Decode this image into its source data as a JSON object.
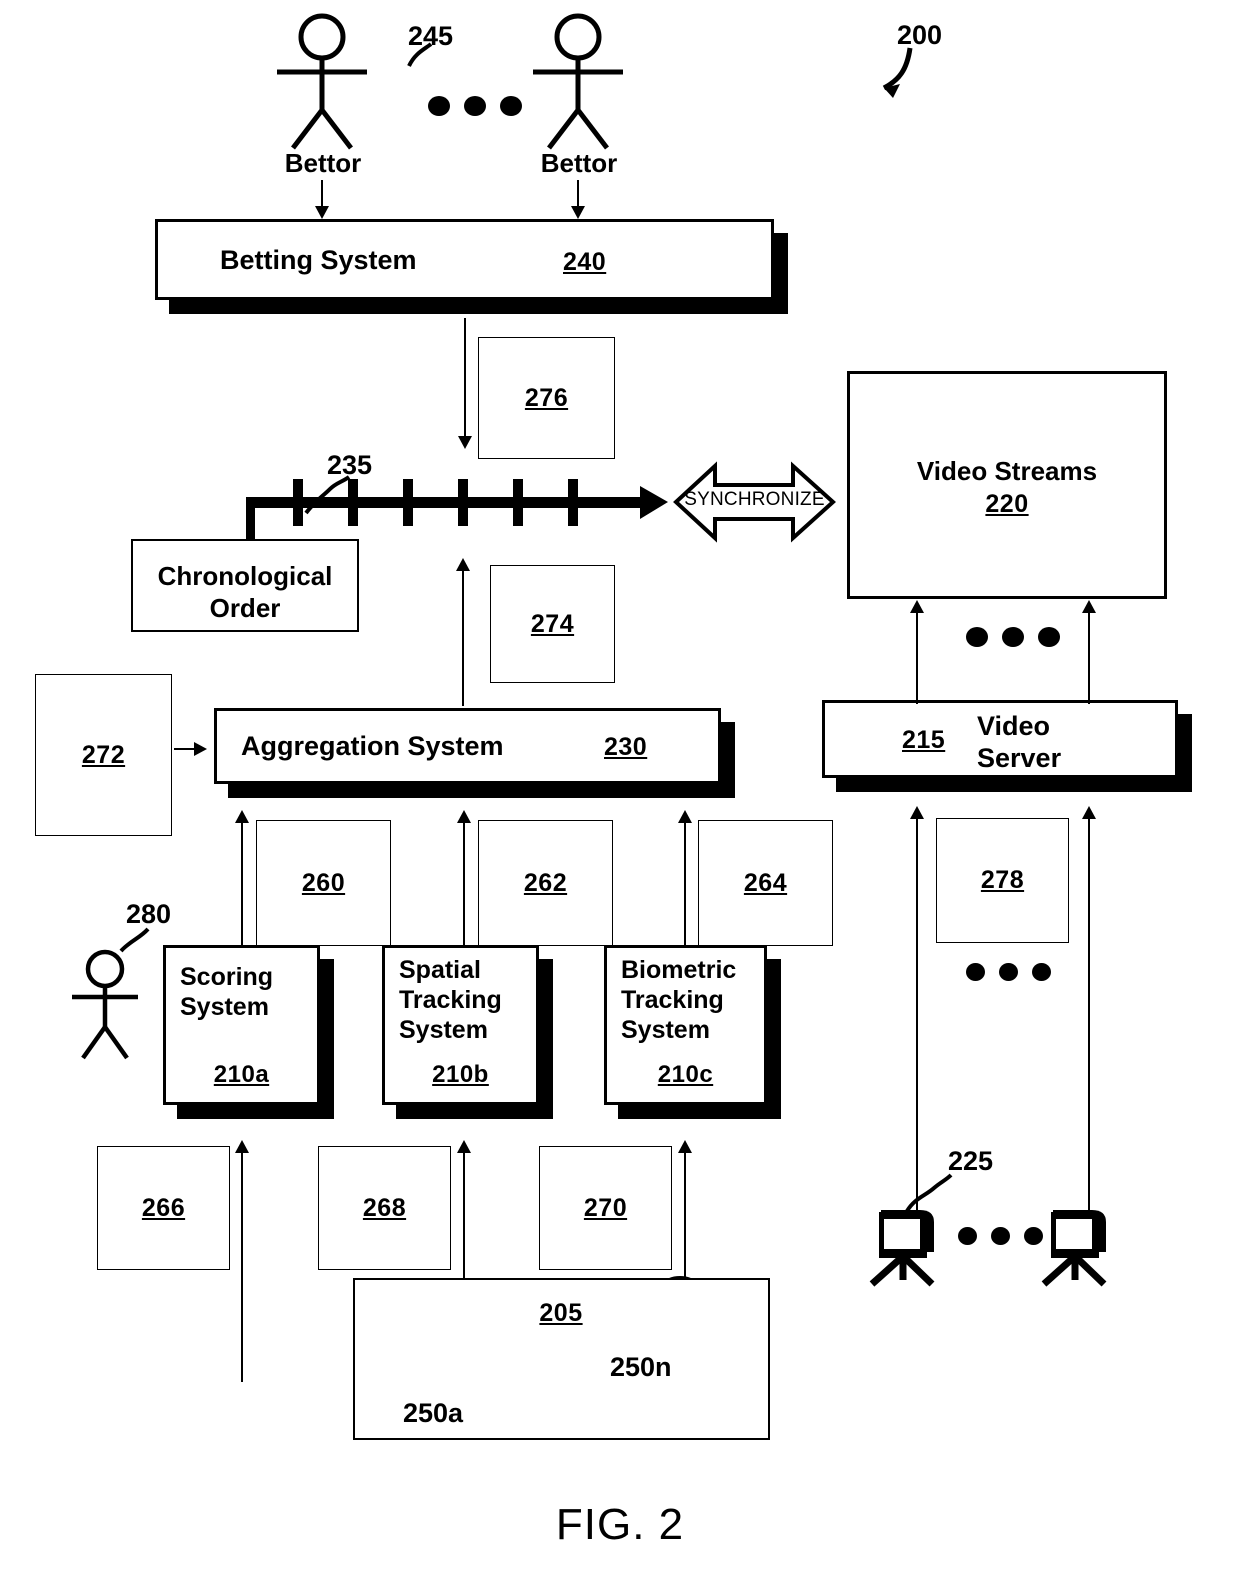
{
  "figure": {
    "caption": "FIG. 2",
    "system_ref": "200"
  },
  "actors": {
    "bettor_left_label": "Bettor",
    "bettor_right_label": "Bettor",
    "bettors_ref": "245",
    "operator_ref": "280"
  },
  "boxes": {
    "betting_system": {
      "label": "Betting System",
      "ref": "240"
    },
    "aggregation_system": {
      "label": "Aggregation System",
      "ref": "230"
    },
    "video_streams": {
      "label": "Video Streams",
      "ref": "220"
    },
    "video_server": {
      "label_line1": "Video",
      "label_line2": "Server",
      "ref": "215"
    },
    "chronological_order": {
      "label_line1": "Chronological",
      "label_line2": "Order"
    },
    "scoring_system": {
      "label_line1": "Scoring",
      "label_line2": "System",
      "ref": "210a"
    },
    "spatial_tracking_system": {
      "label_line1": "Spatial",
      "label_line2": "Tracking",
      "label_line3": "System",
      "ref": "210b"
    },
    "biometric_tracking_system": {
      "label_line1": "Biometric",
      "label_line2": "Tracking",
      "label_line3": "System",
      "ref": "210c"
    },
    "event_venue": {
      "ref": "205"
    }
  },
  "refboxes": {
    "r276": "276",
    "r274": "274",
    "r272": "272",
    "r260": "260",
    "r262": "262",
    "r264": "264",
    "r266": "266",
    "r268": "268",
    "r270": "270",
    "r278": "278"
  },
  "timeline": {
    "ref": "235",
    "tick_count": 6
  },
  "synchronize": {
    "label": "SYNCHRONIZE"
  },
  "participants": {
    "first_ref": "250a",
    "last_ref": "250n"
  },
  "cameras": {
    "ref": "225"
  },
  "colors": {
    "ink": "#000000",
    "paper": "#ffffff"
  }
}
